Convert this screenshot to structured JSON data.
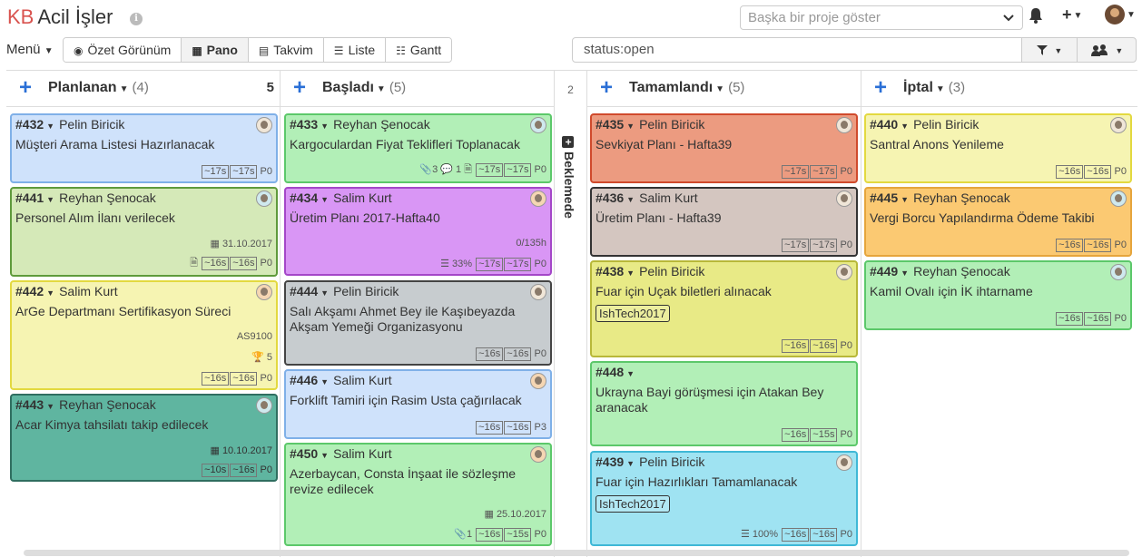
{
  "header": {
    "logo_kb": "KB",
    "title": "Acil İşler",
    "info_glyph": "i",
    "project_placeholder": "Başka bir proje göster",
    "plus_label": "+"
  },
  "toolbar": {
    "menu_label": "Menü",
    "views": [
      {
        "label": "Özet Görünüm",
        "icon": "eye-icon",
        "glyph": "◉",
        "active": false
      },
      {
        "label": "Pano",
        "icon": "grid-icon",
        "glyph": "▦",
        "active": true
      },
      {
        "label": "Takvim",
        "icon": "calendar-icon",
        "glyph": "▤",
        "active": false
      },
      {
        "label": "Liste",
        "icon": "list-icon",
        "glyph": "☰",
        "active": false
      },
      {
        "label": "Gantt",
        "icon": "sliders-icon",
        "glyph": "☷",
        "active": false
      }
    ],
    "search_value": "status:open",
    "filter_glyph": "▼",
    "users_glyph": "👥"
  },
  "columns": [
    {
      "name": "Planlanan",
      "count": "(4)",
      "limit": "5"
    },
    {
      "name": "Başladı",
      "count": "(5)",
      "limit": ""
    },
    {
      "name": "Tamamlandı",
      "count": "(5)",
      "limit": ""
    },
    {
      "name": "İptal",
      "count": "(3)",
      "limit": ""
    }
  ],
  "collapsed": {
    "count": "2",
    "label": "Beklemede",
    "glyph": "+"
  },
  "cards": {
    "c432": {
      "id": "#432",
      "person": "Pelin Biricik",
      "title": "Müşteri Arama Listesi Hazırlanacak",
      "est1": "~17s",
      "est2": "~17s",
      "prio": "P0"
    },
    "c441": {
      "id": "#441",
      "person": "Reyhan Şenocak",
      "title": "Personel Alım İlanı verilecek",
      "date": "31.10.2017",
      "est1": "~16s",
      "est2": "~16s",
      "prio": "P0",
      "doc": "🗎"
    },
    "c442": {
      "id": "#442",
      "person": "Salim Kurt",
      "title": "ArGe Departmanı Sertifikasyon Süreci",
      "ref": "AS9100",
      "score": "5",
      "est1": "~16s",
      "est2": "~16s",
      "prio": "P0"
    },
    "c443": {
      "id": "#443",
      "person": "Reyhan Şenocak",
      "title": "Acar Kimya tahsilatı takip edilecek",
      "date": "10.10.2017",
      "est1": "~10s",
      "est2": "~16s",
      "prio": "P0"
    },
    "c433": {
      "id": "#433",
      "person": "Reyhan Şenocak",
      "title": "Kargoculardan Fiyat Teklifleri Toplanacak",
      "attach": "3",
      "comments": "1",
      "doc": "🗎",
      "est1": "~17s",
      "est2": "~17s",
      "prio": "P0"
    },
    "c434": {
      "id": "#434",
      "person": "Salim Kurt",
      "title": "Üretim Planı 2017-Hafta40",
      "time": "0/135h",
      "progress": "33%",
      "est1": "~17s",
      "est2": "~17s",
      "prio": "P0"
    },
    "c444": {
      "id": "#444",
      "person": "Pelin Biricik",
      "title": "Salı Akşamı Ahmet Bey ile Kaşıbeyazda Akşam Yemeği Organizasyonu",
      "est1": "~16s",
      "est2": "~16s",
      "prio": "P0"
    },
    "c446": {
      "id": "#446",
      "person": "Salim Kurt",
      "title": "Forklift Tamiri için Rasim Usta çağırılacak",
      "est1": "~16s",
      "est2": "~16s",
      "prio": "P3"
    },
    "c450": {
      "id": "#450",
      "person": "Salim Kurt",
      "title": "Azerbaycan, Consta İnşaat ile sözleşme revize edilecek",
      "date": "25.10.2017",
      "attach": "1",
      "est1": "~16s",
      "est2": "~15s",
      "prio": "P0"
    },
    "c435": {
      "id": "#435",
      "person": "Pelin Biricik",
      "title": "Sevkiyat Planı - Hafta39",
      "est1": "~17s",
      "est2": "~17s",
      "prio": "P0"
    },
    "c436": {
      "id": "#436",
      "person": "Salim Kurt",
      "title": "Üretim Planı - Hafta39",
      "est1": "~17s",
      "est2": "~17s",
      "prio": "P0"
    },
    "c438": {
      "id": "#438",
      "person": "Pelin Biricik",
      "title": "Fuar için Uçak biletleri alınacak",
      "tag": "IshTech2017",
      "est1": "~16s",
      "est2": "~16s",
      "prio": "P0"
    },
    "c448": {
      "id": "#448",
      "person": "",
      "title": "Ukrayna Bayi görüşmesi için Atakan Bey aranacak",
      "est1": "~16s",
      "est2": "~15s",
      "prio": "P0"
    },
    "c439": {
      "id": "#439",
      "person": "Pelin Biricik",
      "title": "Fuar için Hazırlıkları Tamamlanacak",
      "tag": "IshTech2017",
      "progress": "100%",
      "est1": "~16s",
      "est2": "~16s",
      "prio": "P0"
    },
    "c440": {
      "id": "#440",
      "person": "Pelin Biricik",
      "title": "Santral Anons Yenileme",
      "est1": "~16s",
      "est2": "~16s",
      "prio": "P0"
    },
    "c445": {
      "id": "#445",
      "person": "Reyhan Şenocak",
      "title": "Vergi Borcu Yapılandırma Ödeme Takibi",
      "est1": "~16s",
      "est2": "~16s",
      "prio": "P0"
    },
    "c449": {
      "id": "#449",
      "person": "Reyhan Şenocak",
      "title": "Kamil Ovalı için İK ihtarname",
      "est1": "~16s",
      "est2": "~16s",
      "prio": "P0"
    }
  },
  "colors": {
    "blue_bg": "#cfe2fb",
    "blue_border": "#7fb0e8",
    "green_bg": "#b2efb7",
    "green_border": "#5cc86a",
    "olive_bg": "#d5e9b8",
    "olive_border": "#5f9a3c",
    "yellow_bg": "#f6f4b2",
    "yellow_border": "#e3d940",
    "teal_bg": "#5fb5a0",
    "teal_border": "#2f6e60",
    "purple_bg": "#d996f5",
    "purple_border": "#a447c8",
    "gray_bg": "#c7cccf",
    "gray_border": "#444",
    "red_bg": "#ec9b80",
    "red_border": "#d04a2c",
    "taupe_bg": "#d4c6c0",
    "taupe_border": "#333",
    "lime_bg": "#e8ea86",
    "lime_border": "#b8b839",
    "cyan_bg": "#9fe3f2",
    "cyan_border": "#3fb8d6",
    "orange_bg": "#fbc972",
    "orange_border": "#e6a53c",
    "accent": "#2a6fd6"
  }
}
